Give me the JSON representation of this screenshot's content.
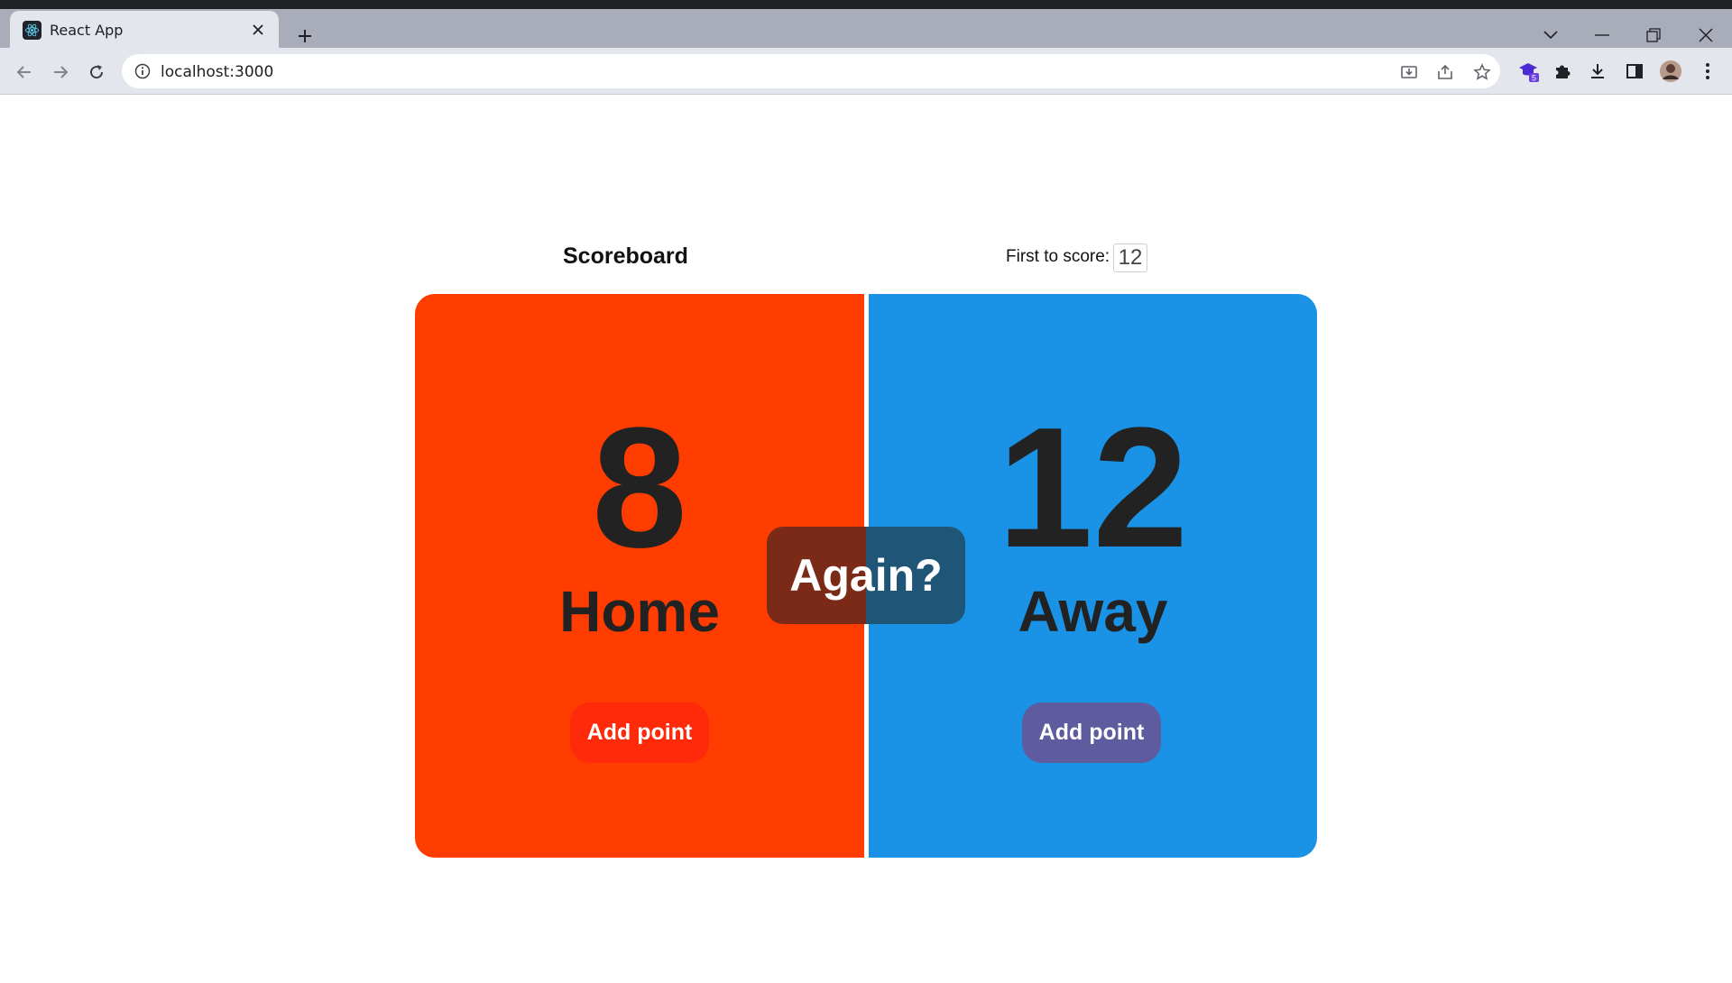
{
  "browser": {
    "tab_title": "React App",
    "url": "localhost:3000",
    "extension_badge": "5"
  },
  "page": {
    "heading": "Scoreboard",
    "target_label": "First to score:",
    "target_value": "12",
    "again_label": "Again?"
  },
  "teams": [
    {
      "name": "Home",
      "score": "8",
      "button_label": "Add point",
      "panel_color": "#ff3d00",
      "button_color": "#ff2a0a"
    },
    {
      "name": "Away",
      "score": "12",
      "button_label": "Add point",
      "panel_color": "#1a93e6",
      "button_color": "#5e5b9e"
    }
  ],
  "icons": {
    "favicon": "react-logo-icon",
    "close": "close-icon",
    "new_tab": "plus-icon",
    "back": "arrow-left-icon",
    "forward": "arrow-right-icon",
    "reload": "reload-icon",
    "info": "info-icon"
  }
}
